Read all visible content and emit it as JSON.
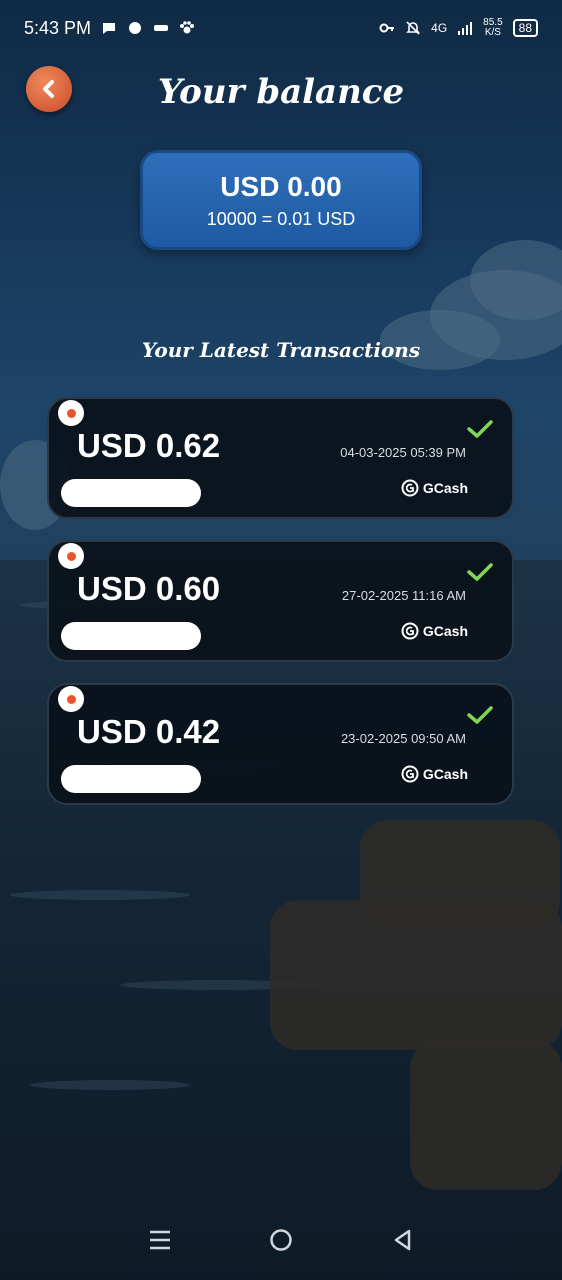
{
  "status_bar": {
    "time": "5:43 PM",
    "network": "4G",
    "speed_value": "85.5",
    "speed_unit": "K/S",
    "battery": "88",
    "icons": [
      "chat-icon",
      "circle-icon",
      "app-icon",
      "paw-icon",
      "key-icon",
      "bell-off-icon",
      "signal-icon",
      "signal-icon"
    ]
  },
  "header": {
    "back_icon": "chevron-left-icon",
    "title": "Your balance"
  },
  "balance": {
    "amount": "USD 0.00",
    "rate": "10000 = 0.01 USD"
  },
  "transactions_title": "Your Latest Transactions",
  "transactions": [
    {
      "amount": "USD 0.62",
      "date": "04-03-2025 05:39 PM",
      "provider": "GCash",
      "status_icon": "check-icon"
    },
    {
      "amount": "USD 0.60",
      "date": "27-02-2025 11:16 AM",
      "provider": "GCash",
      "status_icon": "check-icon"
    },
    {
      "amount": "USD 0.42",
      "date": "23-02-2025 09:50 AM",
      "provider": "GCash",
      "status_icon": "check-icon"
    }
  ],
  "nav": {
    "icons": [
      "menu-icon",
      "home-icon",
      "back-icon"
    ]
  },
  "colors": {
    "accent_orange": "#e9532c",
    "card_blue": "#1f5aa3",
    "check_green": "#7ed957"
  }
}
